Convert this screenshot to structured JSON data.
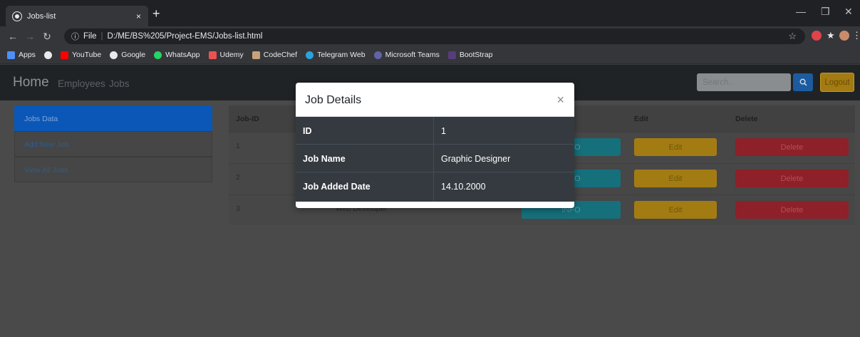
{
  "browser": {
    "tab_title": "Jobs-list",
    "tab_close": "×",
    "new_tab": "+",
    "url_prefix": "File",
    "url": "D:/ME/BS%205/Project-EMS/Jobs-list.html",
    "bookmarks": [
      "Apps",
      "YouTube",
      "Google",
      "WhatsApp",
      "Udemy",
      "CodeChef",
      "Telegram Web",
      "Microsoft Teams",
      "BootStrap"
    ]
  },
  "navbar": {
    "brand": "Home",
    "links": [
      "Employees",
      "Jobs"
    ],
    "search_placeholder": "Search..",
    "logout": "Logout"
  },
  "sidebar": {
    "items": [
      {
        "label": "Jobs Data",
        "active": true
      },
      {
        "label": "Add New Job",
        "active": false
      },
      {
        "label": "View All Jobs",
        "active": false
      }
    ]
  },
  "table": {
    "headers": {
      "id": "Job-ID",
      "edit": "Edit",
      "delete": "Delete"
    },
    "rows": [
      {
        "id": "1",
        "info": "INFO",
        "edit": "Edit",
        "delete": "Delete"
      },
      {
        "id": "2",
        "info": "INFO",
        "edit": "Edit",
        "delete": "Delete"
      },
      {
        "id": "3",
        "name": "Web Developer",
        "info": "INFO",
        "edit": "Edit",
        "delete": "Delete"
      }
    ]
  },
  "modal": {
    "title": "Job Details",
    "close": "×",
    "fields": [
      {
        "label": "ID",
        "value": "1"
      },
      {
        "label": "Job Name",
        "value": "Graphic Designer"
      },
      {
        "label": "Job Added Date",
        "value": "14.10.2000"
      }
    ]
  },
  "colors": {
    "primary": "#0a57b8",
    "info": "#17a2b8",
    "warning": "#ffc107",
    "danger": "#dc3545",
    "dark": "#343a40"
  }
}
